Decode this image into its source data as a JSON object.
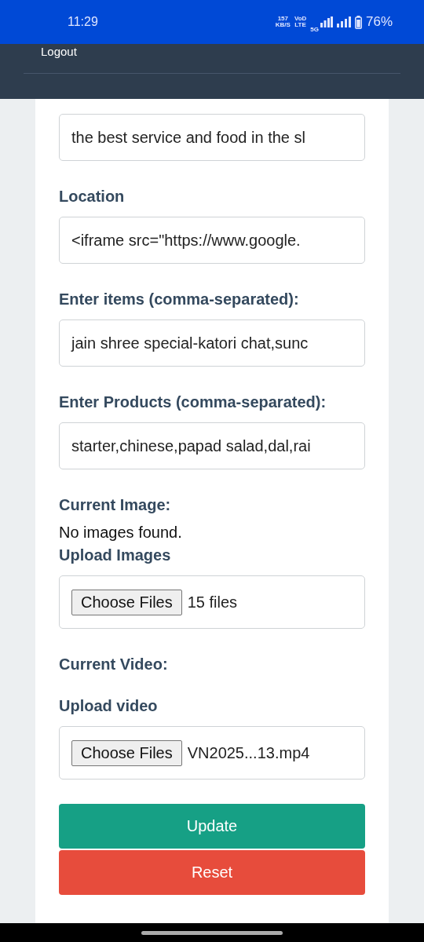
{
  "status_bar": {
    "time": "11:29",
    "speed": "157",
    "speed_unit": "KB/S",
    "network_top": "VoD",
    "network_bottom": "LTE",
    "generation": "5G",
    "battery": "76%"
  },
  "nav": {
    "link": "Logout"
  },
  "form": {
    "fields": [
      {
        "kind": "text",
        "value": "the best service and food in the sl"
      },
      {
        "kind": "text",
        "label": "Location",
        "value": "<iframe src=\"https://www.google."
      },
      {
        "kind": "text",
        "label": "Enter items (comma-separated):",
        "value": "jain shree special-katori chat,sunc"
      },
      {
        "kind": "text",
        "label": "Enter Products (comma-separated):",
        "value": "starter,chinese,papad salad,dal,rai"
      },
      {
        "kind": "file",
        "heading": "Current Image:",
        "note": "No images found.",
        "label": "Upload Images",
        "button": "Choose Files",
        "value": "15 files"
      },
      {
        "kind": "file",
        "heading": "Current Video:",
        "label": "Upload video",
        "button": "Choose Files",
        "value": "VN2025...13.mp4"
      }
    ],
    "buttons": [
      {
        "kind": "submit",
        "label": "Update"
      },
      {
        "kind": "reset",
        "label": "Reset"
      }
    ]
  }
}
